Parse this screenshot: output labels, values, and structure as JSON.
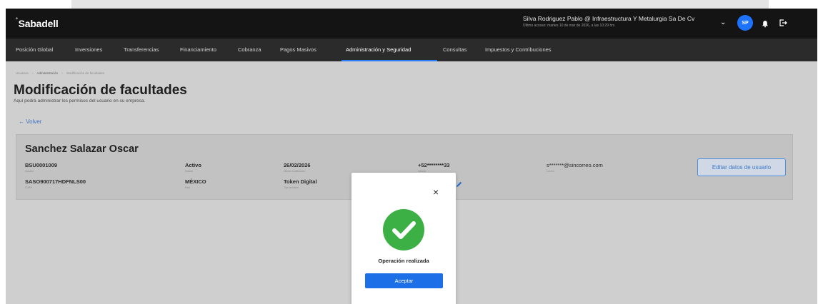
{
  "header": {
    "logo": "Sabadell",
    "logo_dot": "°",
    "user_name": "Silva Rodriguez Pablo @ Infraestructura Y Metalurgia Sa De Cv",
    "last_access": "Último acceso: martes 10 de mar de 2026, a las 10:29 hrs",
    "avatar_initials": "SP",
    "chevron_glyph": "⌄"
  },
  "nav": {
    "items": [
      {
        "label": "Posición Global"
      },
      {
        "label": "Inversiones"
      },
      {
        "label": "Transferencias"
      },
      {
        "label": "Financiamiento"
      },
      {
        "label": "Cobranza"
      },
      {
        "label": "Pagos Masivos"
      },
      {
        "label": "Administración y Seguridad"
      },
      {
        "label": "Consultas"
      },
      {
        "label": "Impuestos y Contribuciones"
      }
    ],
    "active": "Administración y Seguridad"
  },
  "breadcrumb": {
    "items": [
      "Usuarios",
      "Administración",
      "Modificación de facultades"
    ],
    "separator": "›"
  },
  "page": {
    "title": "Modificación de facultades",
    "subtitle": "Aquí podrá administrar los permisos del usuario en su empresa.",
    "back_label": "←  Volver"
  },
  "user_card": {
    "full_name": "Sanchez Salazar Oscar",
    "fields": {
      "user_id": {
        "value": "BSU0001009",
        "label": "Usuario"
      },
      "curp": {
        "value": "SASO900717HDFNLS00",
        "label": "CURP"
      },
      "status": {
        "value": "Activo",
        "label": "Estado"
      },
      "country": {
        "value": "MÉXICO",
        "label": "País"
      },
      "modified": {
        "value": "26/02/2026",
        "label": "Última modificación"
      },
      "token": {
        "value": "Token Digital",
        "label": "Tipo de token"
      },
      "phone": {
        "value": "+52********33",
        "label": "Celular"
      },
      "email": {
        "value": "s*******@sincorreo.com",
        "label": "Correo"
      }
    },
    "edit_button": "Editar datos de usuario"
  },
  "modal": {
    "close_glyph": "×",
    "message": "Operación realizada",
    "accept_button": "Aceptar"
  },
  "colors": {
    "header_bg": "#141414",
    "nav_bg": "#2b2b2b",
    "accent_blue": "#1d6fe8",
    "success_green": "#3cb045"
  },
  "icons": {
    "avatar": "avatar-icon",
    "notifications": "bell-icon",
    "logout": "logout-icon",
    "close": "close-icon",
    "success": "check-circle-icon",
    "edit": "pencil-icon"
  }
}
